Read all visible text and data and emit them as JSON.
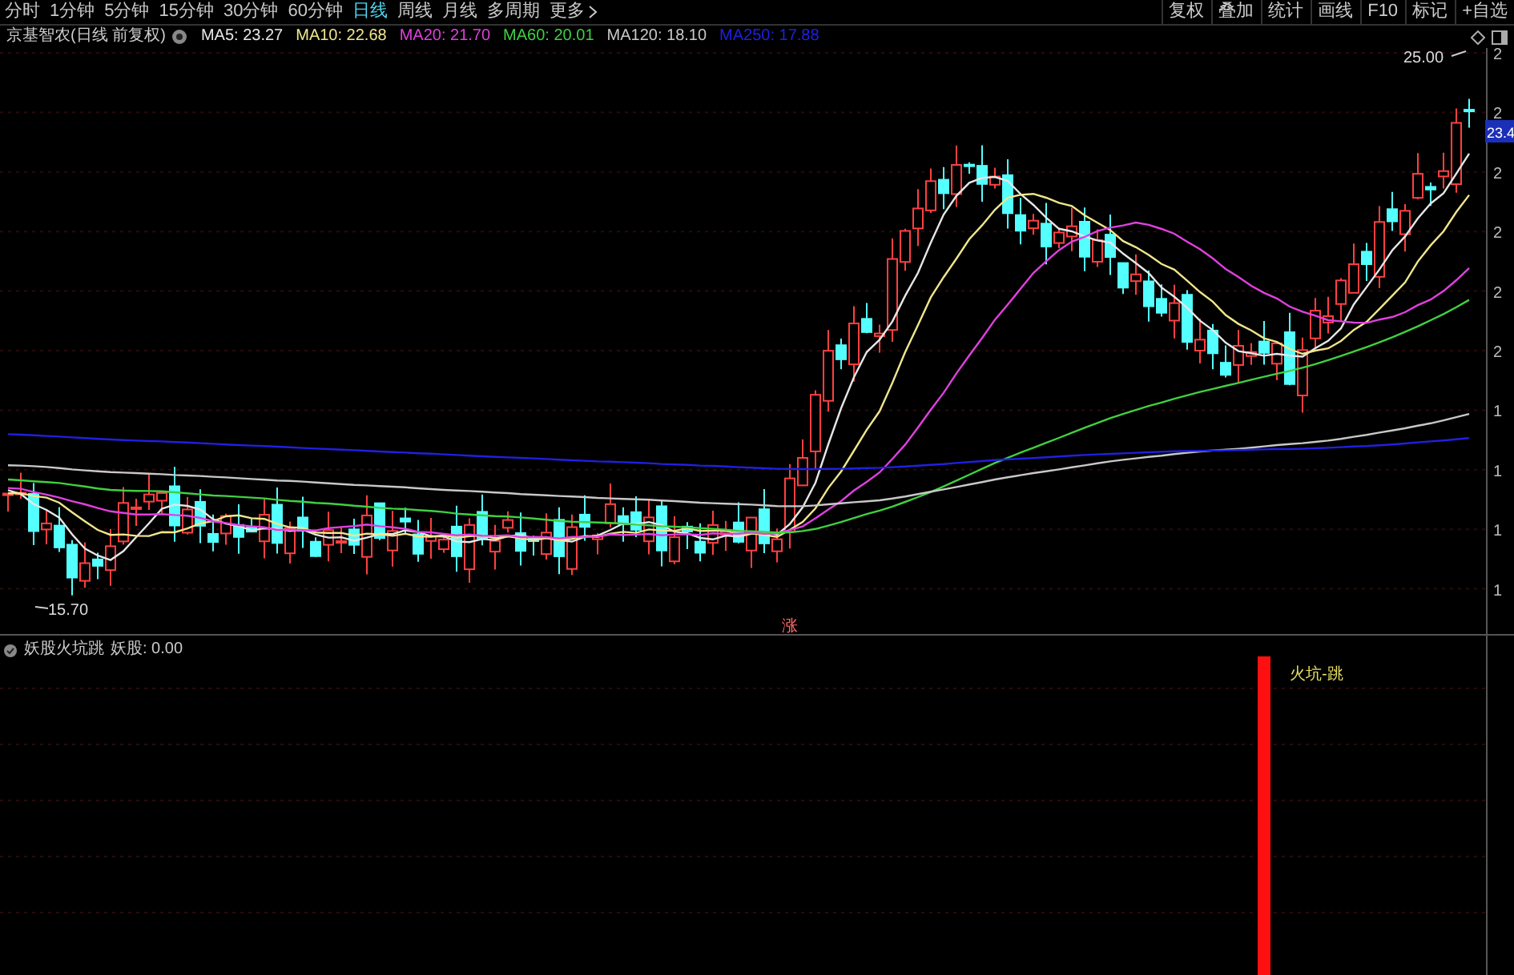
{
  "periods": [
    {
      "label": "分时",
      "selected": false
    },
    {
      "label": "1分钟",
      "selected": false
    },
    {
      "label": "5分钟",
      "selected": false
    },
    {
      "label": "15分钟",
      "selected": false
    },
    {
      "label": "30分钟",
      "selected": false
    },
    {
      "label": "60分钟",
      "selected": false
    },
    {
      "label": "日线",
      "selected": true
    },
    {
      "label": "周线",
      "selected": false
    },
    {
      "label": "月线",
      "selected": false
    },
    {
      "label": "多周期",
      "selected": false
    },
    {
      "label": "更多",
      "selected": false
    }
  ],
  "toolbar_buttons": [
    "复权",
    "叠加",
    "统计",
    "画线",
    "F10",
    "标记",
    "+自选"
  ],
  "legend": {
    "stock": "京基智农(日线 前复权)",
    "mas": [
      {
        "label": "MA5: 23.27",
        "color": "#e6e6e6"
      },
      {
        "label": "MA10: 22.68",
        "color": "#f0e68c"
      },
      {
        "label": "MA20: 21.70",
        "color": "#e040e0"
      },
      {
        "label": "MA60: 20.01",
        "color": "#40d040"
      },
      {
        "label": "MA120: 18.10",
        "color": "#c8c8c8"
      },
      {
        "label": "MA250: 17.88",
        "color": "#2020e0"
      }
    ]
  },
  "price_axis": [
    "2",
    "2",
    "2",
    "2",
    "2",
    "2",
    "1",
    "1",
    "1",
    "1"
  ],
  "price_tag": "23.4",
  "high_label": "25.00",
  "low_label": "15.70",
  "signal_mark": "涨",
  "indicator": {
    "title": "妖股火坑跳",
    "value": "妖股: 0.00",
    "bar_label": "火坑-跳"
  }
}
